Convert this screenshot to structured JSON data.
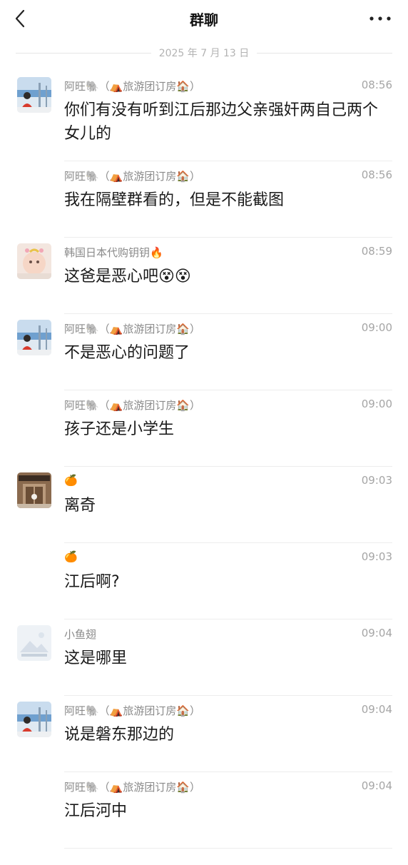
{
  "header": {
    "title": "群聊",
    "back_icon": "chevron-left-icon",
    "more_icon": "ellipsis-icon"
  },
  "date_divider": "2025 年 7 月 13 日",
  "messages": [
    {
      "sender": "阿旺🐘（⛺旅游团订房🏠）",
      "time": "08:56",
      "text": "你们有没有听到江后那边父亲强奸两自己两个女儿的",
      "avatar": "avatar-awang"
    },
    {
      "sender": "阿旺🐘（⛺旅游团订房🏠）",
      "time": "08:56",
      "text": "我在隔壁群看的，但是不能截图",
      "avatar": ""
    },
    {
      "sender": "韩国日本代购钥钥🔥",
      "time": "08:59",
      "text": "这爸是恶心吧😵😵",
      "avatar": "avatar-baby"
    },
    {
      "sender": "阿旺🐘（⛺旅游团订房🏠）",
      "time": "09:00",
      "text": "不是恶心的问题了",
      "avatar": "avatar-awang"
    },
    {
      "sender": "阿旺🐘（⛺旅游团订房🏠）",
      "time": "09:00",
      "text": "孩子还是小学生",
      "avatar": ""
    },
    {
      "sender": "🍊",
      "time": "09:03",
      "text": "离奇",
      "avatar": "avatar-door"
    },
    {
      "sender": "🍊",
      "time": "09:03",
      "text": "江后啊?",
      "avatar": ""
    },
    {
      "sender": "小鱼翅",
      "time": "09:04",
      "text": "这是哪里",
      "avatar": "avatar-placeholder"
    },
    {
      "sender": "阿旺🐘（⛺旅游团订房🏠）",
      "time": "09:04",
      "text": "说是磐东那边的",
      "avatar": "avatar-awang"
    },
    {
      "sender": "阿旺🐘（⛺旅游团订房🏠）",
      "time": "09:04",
      "text": "江后河中",
      "avatar": ""
    }
  ]
}
